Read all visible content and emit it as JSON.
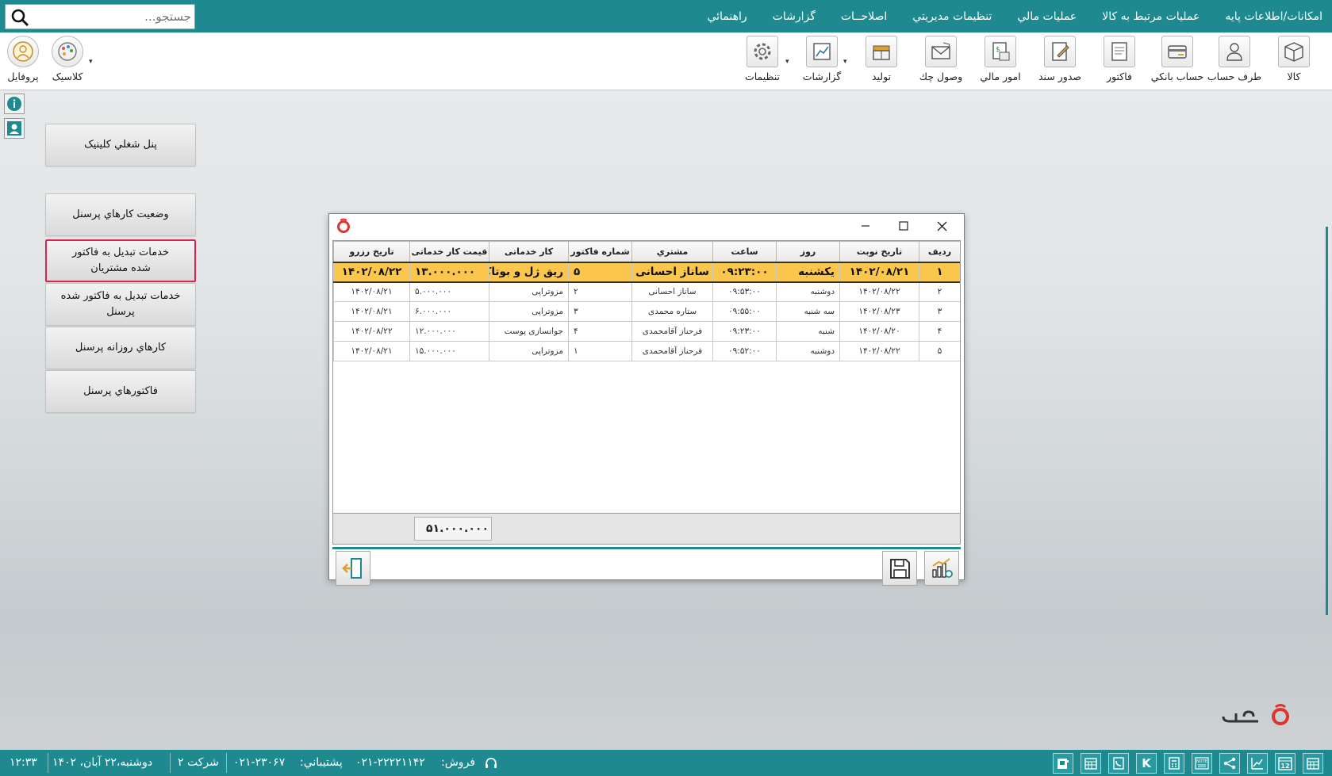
{
  "menu": {
    "items": [
      "امکانات/اطلاعات پايه",
      "عمليات مرتبط به کالا",
      "عمليات مالي",
      "تنظيمات مديريتي",
      "اصلاحــات",
      "گزارشات",
      "راهنمائي"
    ],
    "search_placeholder": "جستجو..."
  },
  "toolbar": {
    "buttons": [
      {
        "label": "کالا",
        "icon": "box-icon"
      },
      {
        "label": "طرف حساب",
        "icon": "person-icon"
      },
      {
        "label": "حساب بانکي",
        "icon": "bank-card-icon"
      },
      {
        "label": "فاکتور",
        "icon": "invoice-icon"
      },
      {
        "label": "صدور سند",
        "icon": "document-icon"
      },
      {
        "label": "امور مالي",
        "icon": "finance-icon"
      },
      {
        "label": "وصول چك",
        "icon": "envelope-icon"
      },
      {
        "label": "توليد",
        "icon": "production-icon"
      },
      {
        "label": "گزارشات",
        "icon": "report-icon"
      },
      {
        "label": "تنظيمات",
        "icon": "gear-icon"
      }
    ],
    "left_buttons": [
      {
        "label": "كلاسيک",
        "icon": "palette-icon"
      },
      {
        "label": "پروفايل",
        "icon": "profile-icon"
      }
    ]
  },
  "side_panel": {
    "buttons": [
      "پنل شغلي كلينيک",
      "وضعيت کارهاي پرسنل",
      "خدمات تبدیل به فاکتور شده مشتریان",
      "خدمات تبدیل به فاکتور شده پرسنل",
      "کارهاي روزانه پرسنل",
      "فاکتورهاي پرسنل"
    ],
    "active_index": 2
  },
  "dialog": {
    "columns": [
      "رديف",
      "تاريخ نوبت",
      "روز",
      "ساعت",
      "مشتري",
      "شماره فاكتور",
      "کار خدماتی",
      "قيمت کار خدماتی",
      "تاريخ رزرو"
    ],
    "rows": [
      [
        "۱",
        "۱۴۰۲/۰۸/۲۱",
        "یکشنبه",
        "۰۹:۲۳:۰۰",
        "ساناز احسانی",
        "۵",
        "ریق ژل و بوتاکس",
        "۱۳.۰۰۰.۰۰۰",
        "۱۴۰۲/۰۸/۲۲"
      ],
      [
        "۲",
        "۱۴۰۲/۰۸/۲۲",
        "دوشنبه",
        "۰۹:۵۳:۰۰",
        "ساناز احسانی",
        "۲",
        "مزوتراپی",
        "۵.۰۰۰.۰۰۰",
        "۱۴۰۲/۰۸/۲۱"
      ],
      [
        "۳",
        "۱۴۰۲/۰۸/۲۳",
        "سه شنبه",
        "۰۹:۵۵:۰۰",
        "ستاره محمدی",
        "۳",
        "مزوتراپی",
        "۶.۰۰۰.۰۰۰",
        "۱۴۰۲/۰۸/۲۱"
      ],
      [
        "۴",
        "۱۴۰۲/۰۸/۲۰",
        "شنبه",
        "۰۹:۲۳:۰۰",
        "فرحناز آقامحمدی",
        "۴",
        "جوانسازی پوست",
        "۱۲.۰۰۰.۰۰۰",
        "۱۴۰۲/۰۸/۲۲"
      ],
      [
        "۵",
        "۱۴۰۲/۰۸/۲۲",
        "دوشنبه",
        "۰۹:۵۲:۰۰",
        "فرحناز آقامحمدی",
        "۱",
        "مزوتراپی",
        "۱۵.۰۰۰.۰۰۰",
        "۱۴۰۲/۰۸/۲۱"
      ]
    ],
    "selected_row": 0,
    "total": "۵۱.۰۰۰.۰۰۰"
  },
  "status": {
    "sales_label": "فروش:",
    "sales_phone": "۰۲۱-۲۲۲۲۱۱۴۲",
    "support_label": "پشتيباني:",
    "support_phone": "۰۲۱-۲۳۰۶۷",
    "company": "شرکت ۲",
    "date": "دوشنبه،۲۲ آبان، ۱۴۰۲",
    "time": "۱۲:۳۳",
    "calendar_day": "12",
    "k_label": "K",
    "note_label": "NOTE"
  },
  "colors": {
    "teal": "#1e8a8f",
    "selected_row": "#fbc64c",
    "active_border": "#d8244f",
    "brand_red": "#e0322f"
  }
}
